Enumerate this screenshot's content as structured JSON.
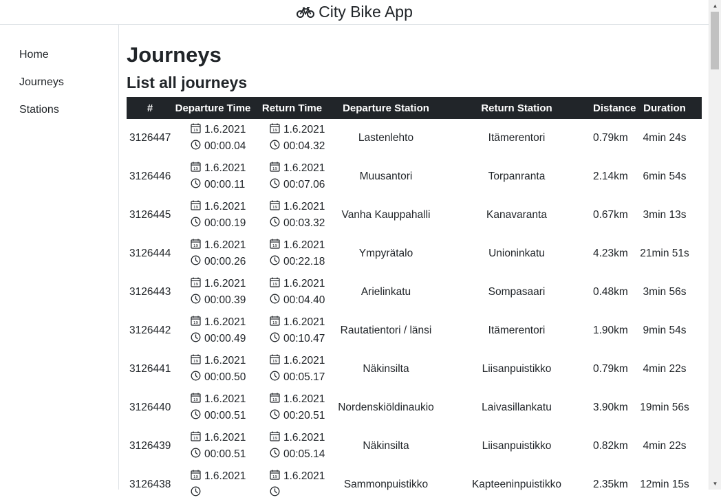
{
  "app": {
    "title": "City Bike App",
    "icon": "bicycle-icon"
  },
  "nav": {
    "items": [
      {
        "label": "Home"
      },
      {
        "label": "Journeys"
      },
      {
        "label": "Stations"
      }
    ]
  },
  "page": {
    "title": "Journeys",
    "subtitle": "List all journeys"
  },
  "table": {
    "headers": {
      "id": "#",
      "departure_time": "Departure Time",
      "return_time": "Return Time",
      "departure_station": "Departure Station",
      "return_station": "Return Station",
      "distance": "Distance",
      "duration": "Duration"
    },
    "rows": [
      {
        "id": "3126447",
        "dep_date": "1.6.2021",
        "dep_time": "00:00.04",
        "ret_date": "1.6.2021",
        "ret_time": "00:04.32",
        "dep_station": "Lastenlehto",
        "ret_station": "Itämerentori",
        "distance": "0.79km",
        "duration": "4min 24s"
      },
      {
        "id": "3126446",
        "dep_date": "1.6.2021",
        "dep_time": "00:00.11",
        "ret_date": "1.6.2021",
        "ret_time": "00:07.06",
        "dep_station": "Muusantori",
        "ret_station": "Torpanranta",
        "distance": "2.14km",
        "duration": "6min 54s"
      },
      {
        "id": "3126445",
        "dep_date": "1.6.2021",
        "dep_time": "00:00.19",
        "ret_date": "1.6.2021",
        "ret_time": "00:03.32",
        "dep_station": "Vanha Kauppahalli",
        "ret_station": "Kanavaranta",
        "distance": "0.67km",
        "duration": "3min 13s"
      },
      {
        "id": "3126444",
        "dep_date": "1.6.2021",
        "dep_time": "00:00.26",
        "ret_date": "1.6.2021",
        "ret_time": "00:22.18",
        "dep_station": "Ympyrätalo",
        "ret_station": "Unioninkatu",
        "distance": "4.23km",
        "duration": "21min 51s"
      },
      {
        "id": "3126443",
        "dep_date": "1.6.2021",
        "dep_time": "00:00.39",
        "ret_date": "1.6.2021",
        "ret_time": "00:04.40",
        "dep_station": "Arielinkatu",
        "ret_station": "Sompasaari",
        "distance": "0.48km",
        "duration": "3min 56s"
      },
      {
        "id": "3126442",
        "dep_date": "1.6.2021",
        "dep_time": "00:00.49",
        "ret_date": "1.6.2021",
        "ret_time": "00:10.47",
        "dep_station": "Rautatientori / länsi",
        "ret_station": "Itämerentori",
        "distance": "1.90km",
        "duration": "9min 54s"
      },
      {
        "id": "3126441",
        "dep_date": "1.6.2021",
        "dep_time": "00:00.50",
        "ret_date": "1.6.2021",
        "ret_time": "00:05.17",
        "dep_station": "Näkinsilta",
        "ret_station": "Liisanpuistikko",
        "distance": "0.79km",
        "duration": "4min 22s"
      },
      {
        "id": "3126440",
        "dep_date": "1.6.2021",
        "dep_time": "00:00.51",
        "ret_date": "1.6.2021",
        "ret_time": "00:20.51",
        "dep_station": "Nordenskiöldinaukio",
        "ret_station": "Laivasillankatu",
        "distance": "3.90km",
        "duration": "19min 56s"
      },
      {
        "id": "3126439",
        "dep_date": "1.6.2021",
        "dep_time": "00:00.51",
        "ret_date": "1.6.2021",
        "ret_time": "00:05.14",
        "dep_station": "Näkinsilta",
        "ret_station": "Liisanpuistikko",
        "distance": "0.82km",
        "duration": "4min 22s"
      },
      {
        "id": "3126438",
        "dep_date": "1.6.2021",
        "dep_time": "",
        "ret_date": "1.6.2021",
        "ret_time": "",
        "dep_station": "Sammonpuistikko",
        "ret_station": "Kapteeninpuistikko",
        "distance": "2.35km",
        "duration": "12min 15s"
      }
    ]
  },
  "icons": {
    "date": "calendar-icon",
    "time": "clock-icon"
  }
}
